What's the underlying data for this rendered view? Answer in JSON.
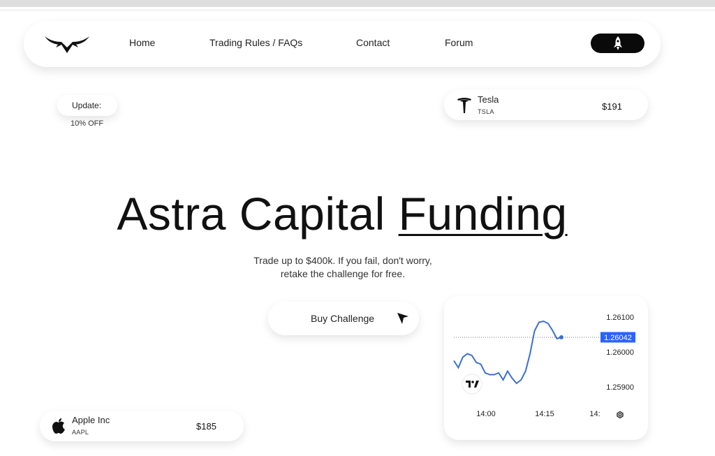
{
  "nav": {
    "links": [
      "Home",
      "Trading Rules / FAQs",
      "Contact",
      "Forum"
    ]
  },
  "update": {
    "label": "Update:",
    "offer": "10% OFF"
  },
  "tickers": {
    "tesla": {
      "name": "Tesla",
      "symbol": "TSLA",
      "price": "$191"
    },
    "apple": {
      "name": "Apple Inc",
      "symbol": "AAPL",
      "price": "$185"
    }
  },
  "hero": {
    "title_main": "Astra Capital ",
    "title_underlined": "Funding",
    "subtitle_line1": "Trade up to $400k. If you fail, don't worry,",
    "subtitle_line2": "retake the challenge for free."
  },
  "cta": {
    "buy_label": "Buy Challenge"
  },
  "chart_data": {
    "type": "line",
    "x_ticks": [
      "14:00",
      "14:15",
      "14:"
    ],
    "y_ticks": [
      "1.26100",
      "1.26000",
      "1.25900"
    ],
    "last_price_label": "1.26042",
    "last_price": 1.26042,
    "ylim": [
      1.2586,
      1.2612
    ],
    "values": [
      1.25975,
      1.25955,
      1.25985,
      1.25995,
      1.2599,
      1.2597,
      1.25965,
      1.2594,
      1.25935,
      1.25935,
      1.2594,
      1.2592,
      1.25945,
      1.25925,
      1.2591,
      1.2592,
      1.25945,
      1.25995,
      1.2606,
      1.26085,
      1.26088,
      1.26082,
      1.26062,
      1.26038,
      1.26042
    ],
    "accent_color": "#3b6fd4"
  }
}
